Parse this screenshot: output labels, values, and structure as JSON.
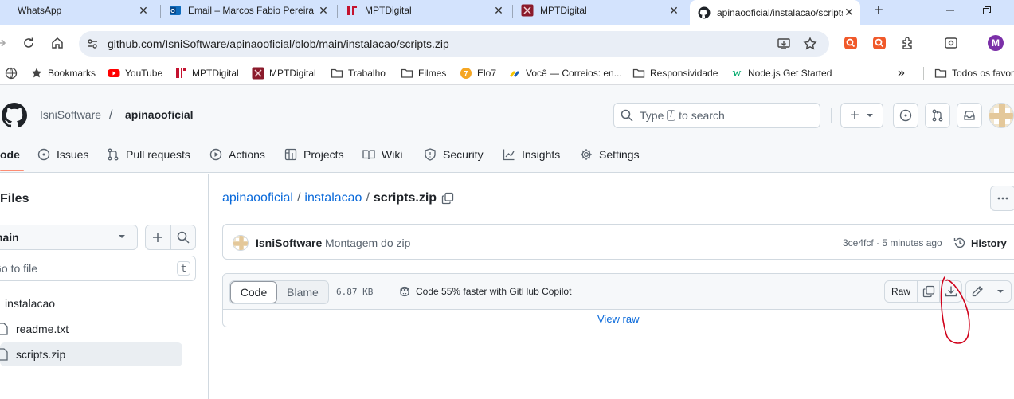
{
  "browser": {
    "tabs": [
      {
        "title": "WhatsApp",
        "icon": "whatsapp-icon",
        "close": "✕"
      },
      {
        "title": "Email – Marcos Fabio Pereira",
        "icon": "outlook-icon",
        "close": "✕"
      },
      {
        "title": "MPTDigital",
        "icon": "mptdigital-icon",
        "close": "✕"
      },
      {
        "title": "MPTDigital",
        "icon": "mptdigital-alt-icon",
        "close": "✕"
      },
      {
        "title": "apinaooficial/instalacao/scripts.zip",
        "icon": "github-icon",
        "close": "✕",
        "active": true
      }
    ],
    "new_tab": "+",
    "url": "github.com/IsniSoftware/apinaooficial/blob/main/instalacao/scripts.zip",
    "profile_initial": "M",
    "bookmarks": [
      {
        "label": "Bookmarks",
        "icon": "star-icon"
      },
      {
        "label": "YouTube",
        "icon": "youtube-icon"
      },
      {
        "label": "MPTDigital",
        "icon": "mptdigital-icon"
      },
      {
        "label": "MPTDigital",
        "icon": "mptdigital-alt-icon"
      },
      {
        "label": "Trabalho",
        "icon": "folder-icon"
      },
      {
        "label": "Filmes",
        "icon": "folder-icon"
      },
      {
        "label": "Elo7",
        "icon": "elo7-icon"
      },
      {
        "label": "Você — Correios: en...",
        "icon": "correios-icon"
      },
      {
        "label": "Responsividade",
        "icon": "folder-icon"
      },
      {
        "label": "Node.js Get Started",
        "icon": "w3schools-icon"
      }
    ],
    "bookmarks_overflow": "»",
    "all_bookmarks": "Todos os favor"
  },
  "github": {
    "owner": "IsniSoftware",
    "slash": "/",
    "repo": "apinaooficial",
    "search_prefix": "Type",
    "search_key": "/",
    "search_suffix": "to search",
    "plus": "+",
    "nav": [
      {
        "label": "ode",
        "icon": "code-icon"
      },
      {
        "label": "Issues",
        "icon": "issue-icon"
      },
      {
        "label": "Pull requests",
        "icon": "pull-request-icon"
      },
      {
        "label": "Actions",
        "icon": "actions-icon"
      },
      {
        "label": "Projects",
        "icon": "projects-icon"
      },
      {
        "label": "Wiki",
        "icon": "book-icon"
      },
      {
        "label": "Security",
        "icon": "shield-icon"
      },
      {
        "label": "Insights",
        "icon": "graph-icon"
      },
      {
        "label": "Settings",
        "icon": "gear-icon"
      }
    ]
  },
  "sidebar": {
    "title": "Files",
    "branch": "main",
    "goto_placeholder": "Go to file",
    "goto_key": "t",
    "tree": [
      {
        "label": "instalacao",
        "type": "folder"
      },
      {
        "label": "readme.txt",
        "type": "file"
      },
      {
        "label": "scripts.zip",
        "type": "file",
        "selected": true
      }
    ]
  },
  "file": {
    "path": [
      "apinaooficial",
      "instalacao"
    ],
    "path_sep": "/",
    "name": "scripts.zip",
    "commit": {
      "author": "IsniSoftware",
      "message": "Montagem do zip",
      "meta": "3ce4fcf · 5 minutes ago",
      "history": "History"
    },
    "tabs": {
      "code": "Code",
      "blame": "Blame"
    },
    "size": "6.87 KB",
    "copilot": "Code 55% faster with GitHub Copilot",
    "raw": "Raw",
    "view_raw": "View raw"
  },
  "colors": {
    "link": "#0969da",
    "tab_strip": "#d3e3fd",
    "active_underline": "#fd8c73",
    "annotation": "#d0021b"
  }
}
